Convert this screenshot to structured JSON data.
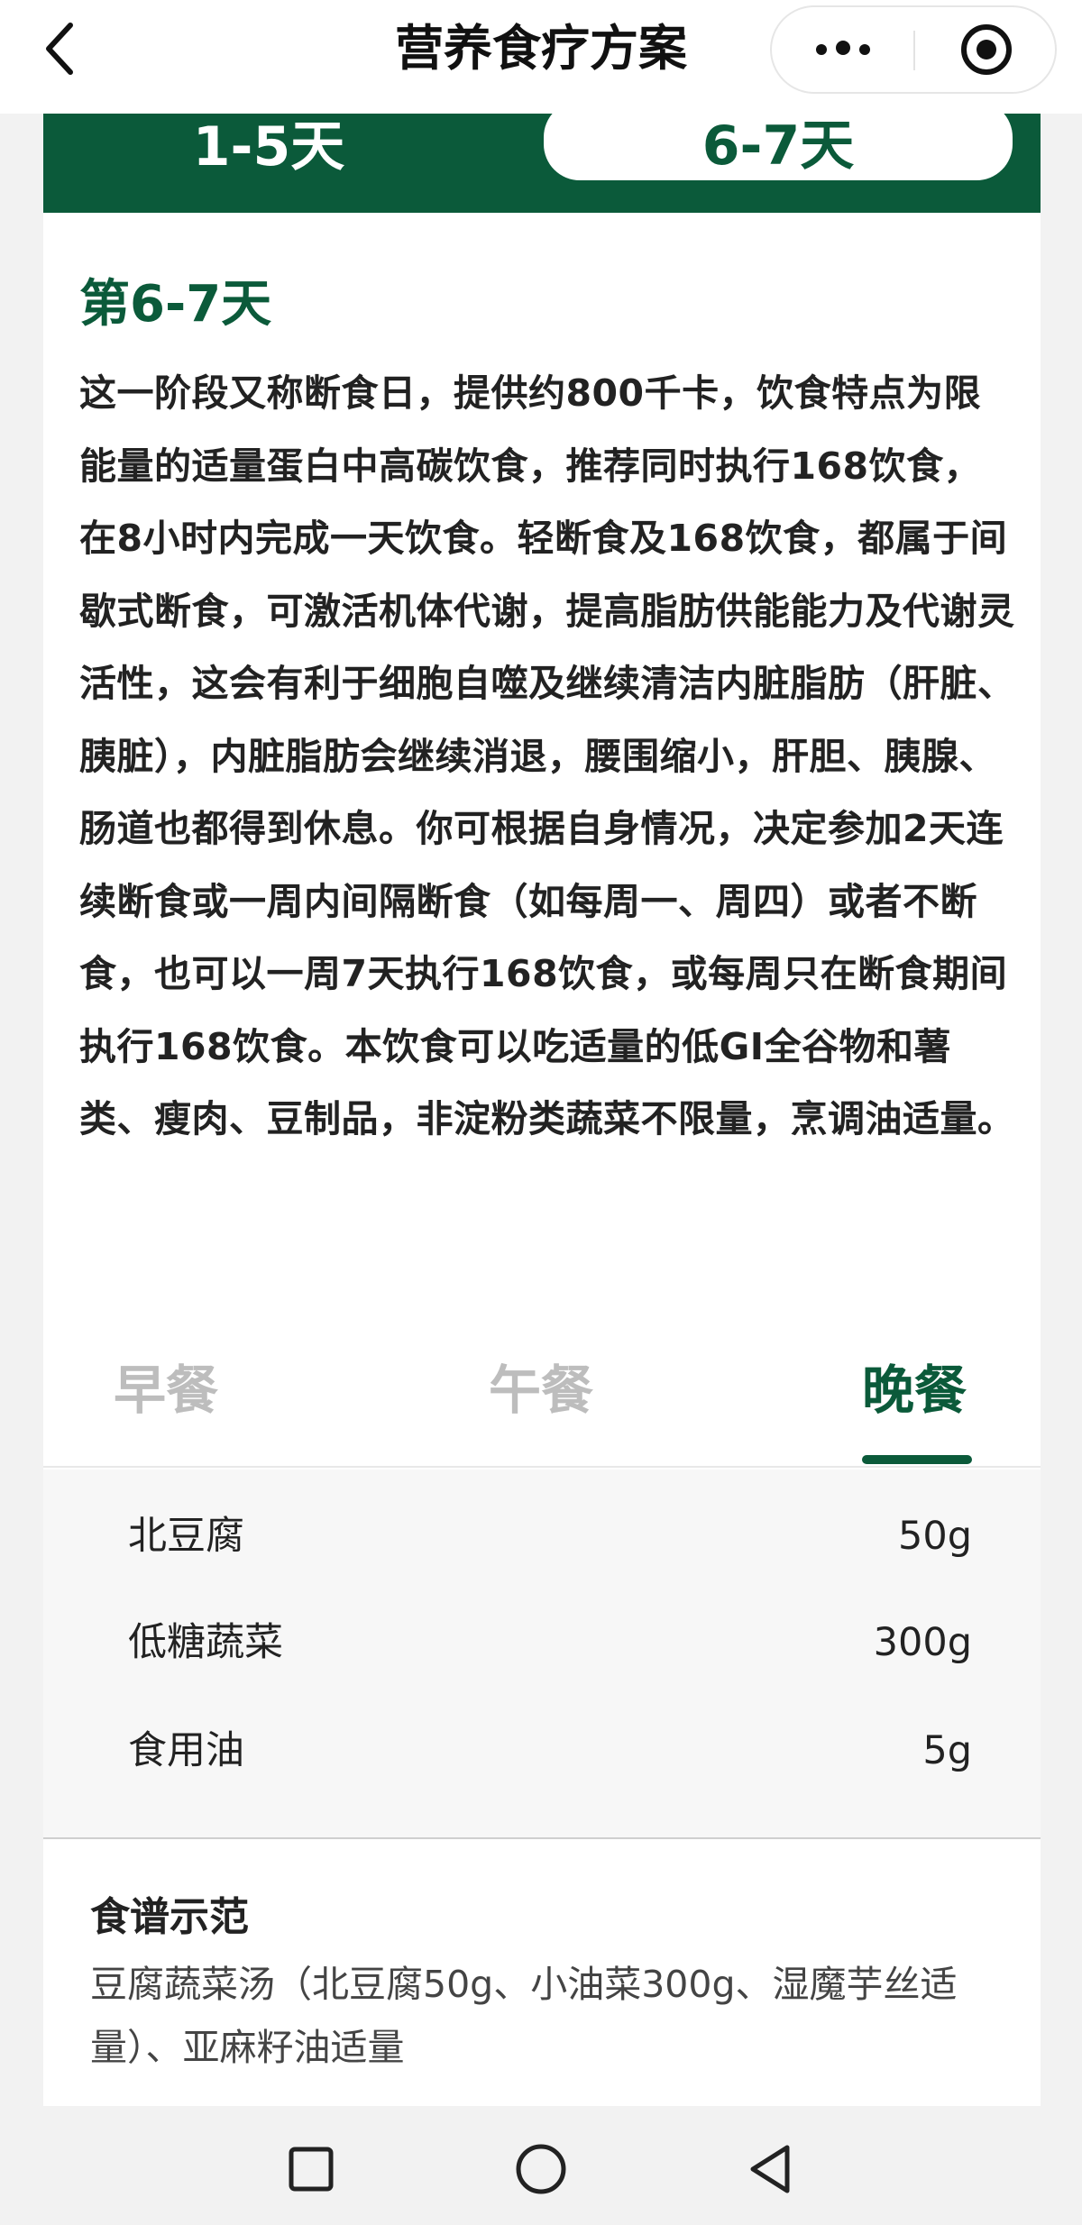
{
  "nav": {
    "title": "营养食疗方案",
    "back_icon": "chevron-left-icon",
    "more_icon": "more-dots-icon",
    "close_icon": "target-close-icon"
  },
  "day_tabs": [
    {
      "label": "1-5天",
      "active": false
    },
    {
      "label": "6-7天",
      "active": true
    }
  ],
  "section": {
    "title": "第6-7天",
    "description": "这一阶段又称断食日，提供约800千卡，饮食特点为限能量的适量蛋白中高碳饮食，推荐同时执行168饮食，在8小时内完成一天饮食。轻断食及168饮食，都属于间歇式断食，可激活机体代谢，提高脂肪供能能力及代谢灵活性，这会有利于细胞自噬及继续清洁内脏脂肪（肝脏、胰脏），内脏脂肪会继续消退，腰围缩小，肝胆、胰腺、肠道也都得到休息。你可根据自身情况，决定参加2天连续断食或一周内间隔断食（如每周一、周四）或者不断食，也可以一周7天执行168饮食，或每周只在断食期间执行168饮食。本饮食可以吃适量的低GI全谷物和薯类、瘦肉、豆制品，非淀粉类蔬菜不限量，烹调油适量。"
  },
  "meal_tabs": [
    {
      "label": "早餐",
      "active": false
    },
    {
      "label": "午餐",
      "active": false
    },
    {
      "label": "晚餐",
      "active": true
    }
  ],
  "ingredients": [
    {
      "name": "北豆腐",
      "qty": "50g"
    },
    {
      "name": "低糖蔬菜",
      "qty": "300g"
    },
    {
      "name": "食用油",
      "qty": "5g"
    }
  ],
  "recipe": {
    "title": "食谱示范",
    "text": "豆腐蔬菜汤（北豆腐50g、小油菜300g、湿魔芋丝适量）、亚麻籽油适量"
  },
  "system_nav": {
    "buttons": [
      "recent-apps-square-icon",
      "home-circle-icon",
      "back-triangle-icon"
    ]
  },
  "colors": {
    "brand_green": "#0b5a3a",
    "inactive_tab": "#bdbdbd"
  }
}
